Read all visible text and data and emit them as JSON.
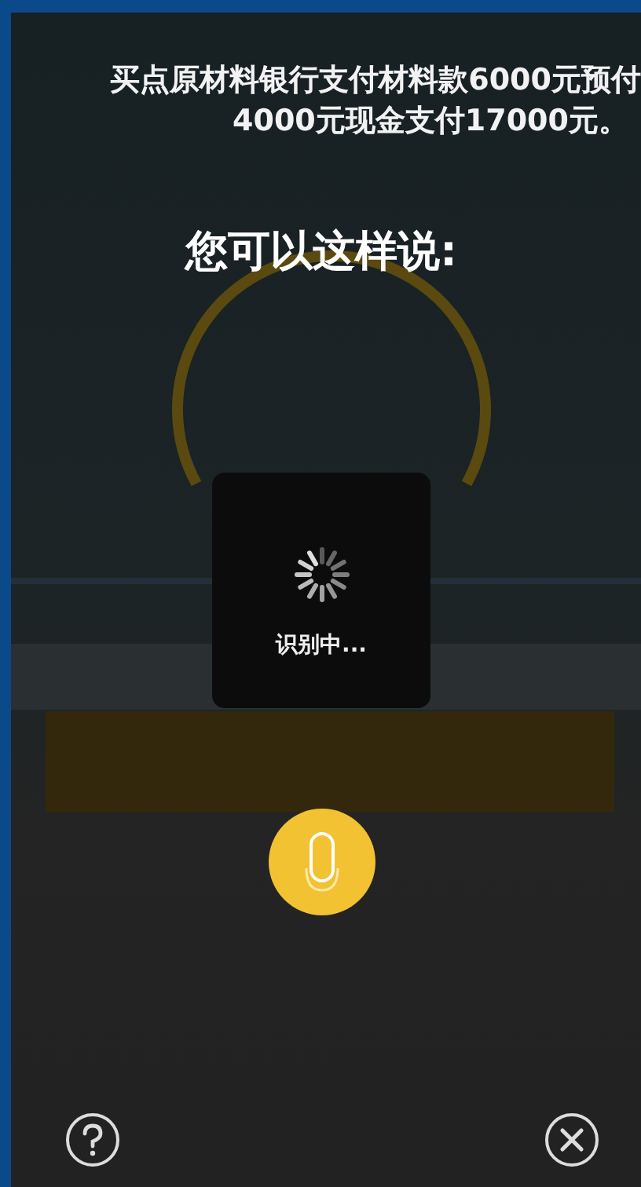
{
  "example": {
    "lines": [
      "买点原材料银行支付材料款6000元预付",
      "4000元现金支付17000元。"
    ]
  },
  "prompt": "您可以这样说:",
  "toast": {
    "text": "识别中..."
  },
  "mic_button": {
    "kind": "mic"
  },
  "bottom_bar": {
    "buttons": [
      {
        "kind": "help"
      },
      {
        "kind": "close"
      }
    ]
  }
}
